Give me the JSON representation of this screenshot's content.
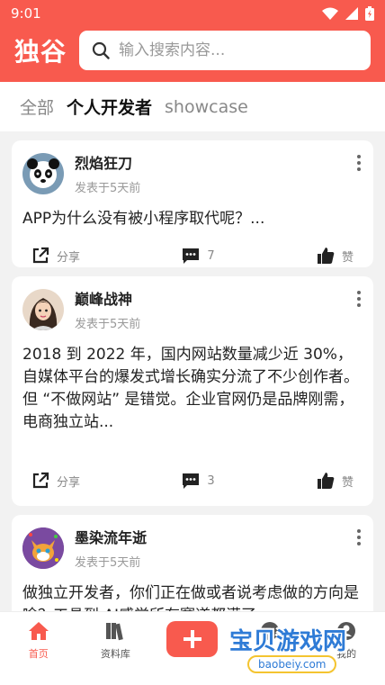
{
  "status": {
    "time": "9:01"
  },
  "header": {
    "logo": "独谷",
    "search_placeholder": "输入搜索内容..."
  },
  "tabs": [
    {
      "label": "全部"
    },
    {
      "label": "个人开发者"
    },
    {
      "label": "showcase"
    }
  ],
  "posts": [
    {
      "author": "烈焰狂刀",
      "time": "发表于5天前",
      "content": "APP为什么没有被小程序取代呢？...",
      "share_label": "分享",
      "comments": "7",
      "like_label": "赞",
      "avatar_icon": "panda-avatar"
    },
    {
      "author": "巅峰战神",
      "time": "发表于5天前",
      "content": "2018 到 2022 年，国内网站数量减少近 30%，自媒体平台的爆发式增长确实分流了不少创作者。\n但 “不做网站” 是错觉。企业官网仍是品牌刚需，电商独立站...",
      "share_label": "分享",
      "comments": "3",
      "like_label": "赞",
      "avatar_icon": "girl-avatar"
    },
    {
      "author": "墨染流年逝",
      "time": "发表于5天前",
      "content": "做独立开发者，你们正在做或者说考虑做的方向是啥？工具到 AI感觉所有赛道都满了",
      "avatar_icon": "cat-avatar"
    }
  ],
  "bottom_nav": [
    {
      "label": "首页",
      "icon": "home-icon"
    },
    {
      "label": "资料库",
      "icon": "library-icon"
    },
    {
      "label": "",
      "icon": "add-icon"
    },
    {
      "label": "",
      "icon": "message-icon"
    },
    {
      "label": "我的",
      "icon": "profile-icon"
    }
  ],
  "watermark": {
    "text": "宝贝游戏网",
    "url": "baobeiy.com"
  },
  "colors": {
    "brand": "#f85a4e",
    "watermark": "#2e7bd6"
  }
}
